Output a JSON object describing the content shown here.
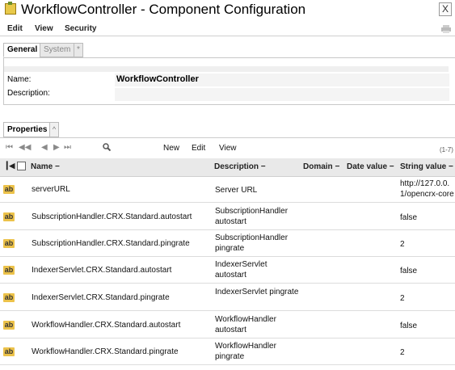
{
  "window": {
    "title": "WorkflowController - Component Configuration",
    "close_label": "X"
  },
  "menu": {
    "items": [
      "Edit",
      "View",
      "Security"
    ]
  },
  "tabs": [
    {
      "label": "General",
      "active": true
    },
    {
      "label": "System",
      "active": false
    },
    {
      "label": "*",
      "active": false
    }
  ],
  "general": {
    "name_label": "Name:",
    "name_value": "WorkflowController",
    "description_label": "Description:",
    "description_value": ""
  },
  "properties_tab": {
    "label": "Properties",
    "extra": "^"
  },
  "toolbar": {
    "nav_icons": [
      "first-page-icon",
      "prev-page-icon",
      "prev-icon",
      "next-icon",
      "last-page-icon"
    ],
    "search_icon": "search-icon",
    "buttons": [
      "New",
      "Edit",
      "View"
    ],
    "count": "(1-7)"
  },
  "table": {
    "columns": [
      "Name",
      "Description",
      "Domain",
      "Date value",
      "String value"
    ],
    "rows": [
      {
        "type": "ab",
        "name": "serverURL",
        "description": "Server URL",
        "domain": "",
        "date_value": "",
        "string_value": "http://127.0.0.1/opencrx-core"
      },
      {
        "type": "ab",
        "name": "SubscriptionHandler.CRX.Standard.autostart",
        "description": "SubscriptionHandler autostart",
        "domain": "",
        "date_value": "",
        "string_value": "false"
      },
      {
        "type": "ab",
        "name": "SubscriptionHandler.CRX.Standard.pingrate",
        "description": "SubscriptionHandler pingrate",
        "domain": "",
        "date_value": "",
        "string_value": "2"
      },
      {
        "type": "ab",
        "name": "IndexerServlet.CRX.Standard.autostart",
        "description": "IndexerServlet autostart",
        "domain": "",
        "date_value": "",
        "string_value": "false"
      },
      {
        "type": "ab",
        "name": "IndexerServlet.CRX.Standard.pingrate",
        "description": "IndexerServlet pingrate",
        "domain": "",
        "date_value": "",
        "string_value": "2"
      },
      {
        "type": "ab",
        "name": "WorkflowHandler.CRX.Standard.autostart",
        "description": "WorkflowHandler autostart",
        "domain": "",
        "date_value": "",
        "string_value": "false"
      },
      {
        "type": "ab",
        "name": "WorkflowHandler.CRX.Standard.pingrate",
        "description": "WorkflowHandler pingrate",
        "domain": "",
        "date_value": "",
        "string_value": "2"
      }
    ]
  },
  "colors": {
    "badge": "#ecc24a",
    "header_bg": "#e9e9e9",
    "tab_inactive": "#e8e8e8"
  }
}
